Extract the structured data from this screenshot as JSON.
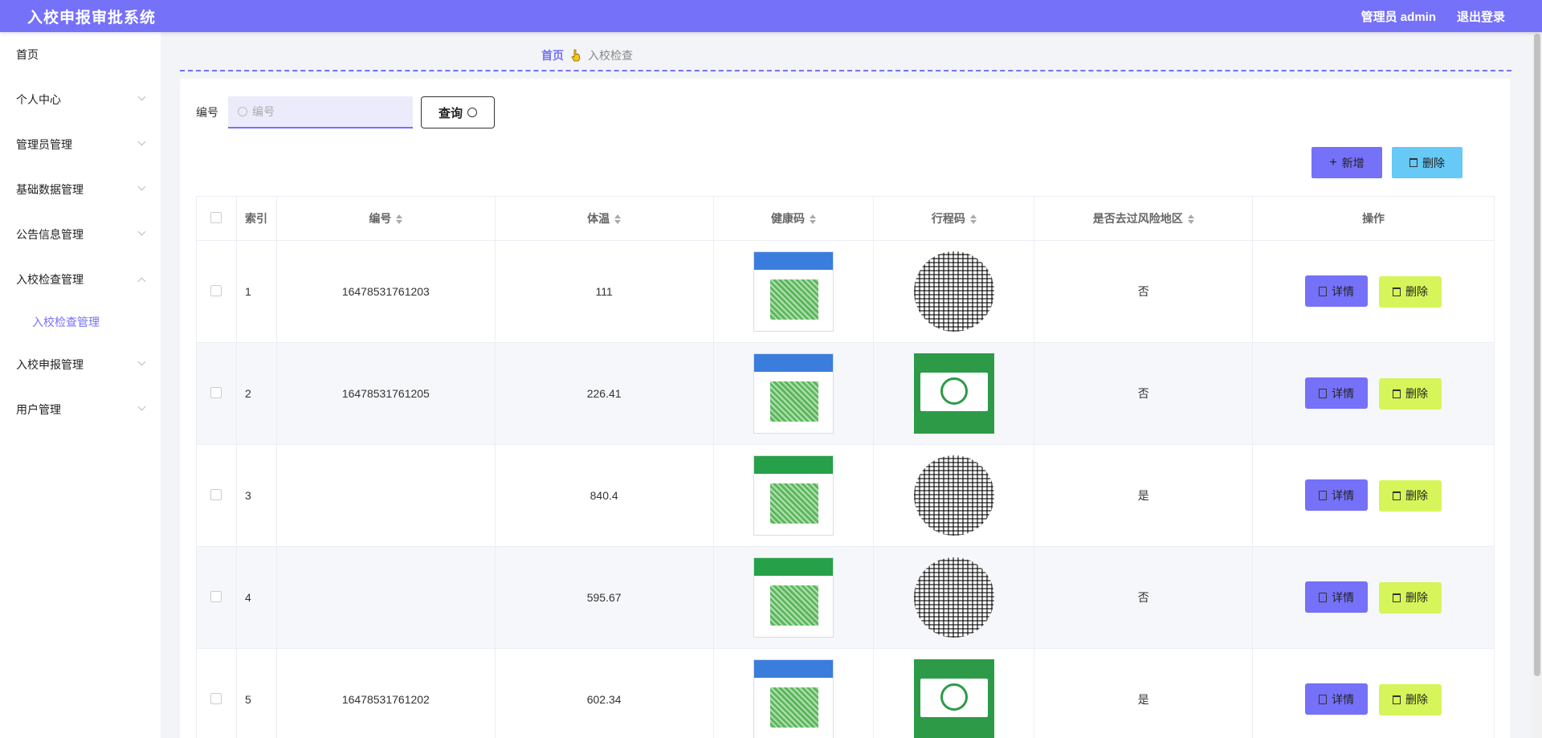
{
  "header": {
    "title": "入校申报审批系统",
    "user": "管理员 admin",
    "logout": "退出登录"
  },
  "sidebar": {
    "items": [
      {
        "label": "首页"
      },
      {
        "label": "个人中心"
      },
      {
        "label": "管理员管理"
      },
      {
        "label": "基础数据管理"
      },
      {
        "label": "公告信息管理"
      },
      {
        "label": "入校检查管理"
      },
      {
        "label": "入校申报管理"
      },
      {
        "label": "用户管理"
      }
    ],
    "active_sub": "入校检查管理"
  },
  "breadcrumb": {
    "home": "首页",
    "current": "入校检查"
  },
  "search": {
    "label": "编号",
    "placeholder": "编号",
    "button": "查询"
  },
  "actions": {
    "add": "新增",
    "delete": "删除"
  },
  "table": {
    "columns": [
      "索引",
      "编号",
      "体温",
      "健康码",
      "行程码",
      "是否去过风险地区",
      "操作"
    ],
    "detail_label": "详情",
    "delete_label": "删除",
    "rows": [
      {
        "index": "1",
        "id": "16478531761203",
        "temp": "111",
        "risk": "否"
      },
      {
        "index": "2",
        "id": "16478531761205",
        "temp": "226.41",
        "risk": "否"
      },
      {
        "index": "3",
        "id": "",
        "temp": "840.4",
        "risk": "是"
      },
      {
        "index": "4",
        "id": "",
        "temp": "595.67",
        "risk": "否"
      },
      {
        "index": "5",
        "id": "16478531761202",
        "temp": "602.34",
        "risk": "是"
      }
    ]
  }
}
